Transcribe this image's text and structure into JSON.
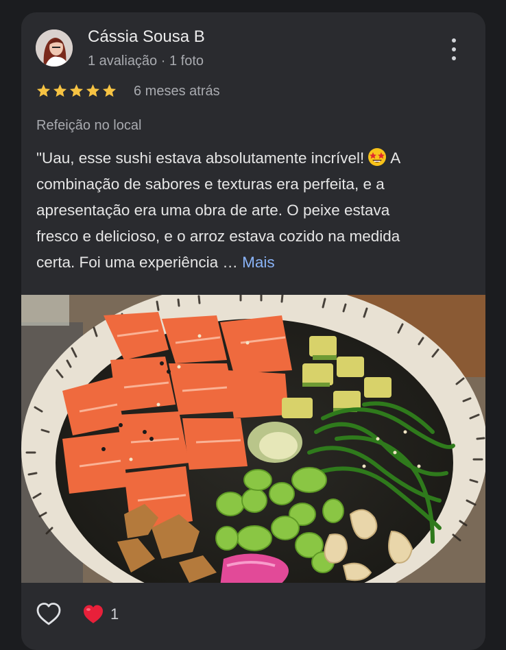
{
  "review": {
    "author_name": "Cássia Sousa B",
    "author_meta": "1 avaliação · 1 foto",
    "rating": 5,
    "rating_max": 5,
    "date": "6 meses atrás",
    "category": "Refeição no local",
    "text_line1_before_emoji": "\"Uau, esse sushi estava absolutamente incrível!",
    "text_line1_after_emoji": "A",
    "text_line2": "combinação de sabores e texturas era perfeita, e a",
    "text_line3": "apresentação era uma obra de arte. O peixe estava",
    "text_line4": "fresco e delicioso, e o arroz estava cozido na medida",
    "text_line5": "certa. Foi uma experiência …",
    "more_link": "Mais",
    "emoji_icon": "star-struck-emoji-icon"
  },
  "actions": {
    "like_icon": "heart-outline-icon",
    "reaction_icon": "red-heart-icon",
    "reaction_count": "1"
  },
  "colors": {
    "background": "#1b1c1f",
    "card": "#2a2b2f",
    "star": "#f6c343",
    "link": "#8ab4f8",
    "heart": "#e8203a"
  }
}
